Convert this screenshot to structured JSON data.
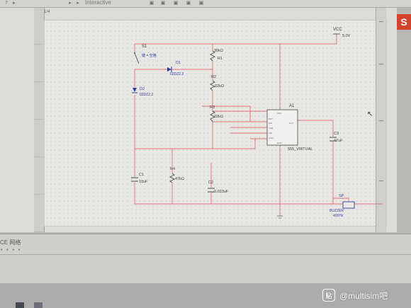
{
  "toolbar": {
    "mode_label": "Interactive"
  },
  "app": {
    "logo_letter": "S"
  },
  "ruler": {
    "label": "1/4"
  },
  "schematic": {
    "vcc": {
      "name": "VCC",
      "value": "5.0V"
    },
    "switch": {
      "ref": "S1",
      "key": "键 = 空格"
    },
    "d1": {
      "ref": "D1",
      "model": "02DZ2.2"
    },
    "d2": {
      "ref": "D2",
      "model": "02DZ2.2"
    },
    "r1": {
      "ref": "R1",
      "value": "30kΩ"
    },
    "r2": {
      "ref": "R2",
      "value": "22kΩ"
    },
    "r3": {
      "ref": "R3",
      "value": "22kΩ"
    },
    "r4": {
      "ref": "R4",
      "value": "47kΩ"
    },
    "c1": {
      "ref": "C1",
      "value": "10uF"
    },
    "c2": {
      "ref": "C2",
      "value": "0.033uF"
    },
    "c3": {
      "ref": "C3",
      "value": "47uF"
    },
    "a1": {
      "ref": "A1",
      "model": "555_VIRTUAL",
      "pins": [
        "VCC",
        "RST",
        "DIS",
        "THR",
        "TRI",
        "CON",
        "GND",
        "OUT"
      ]
    },
    "buzzer": {
      "ref": "SP",
      "model": "BUZZER",
      "freq": "400Hz"
    }
  },
  "spreadsheet": {
    "label": "CE 网络",
    "dots": "• • • •"
  },
  "watermark": {
    "logo": "贴",
    "text": "@multisim吧"
  },
  "colors": {
    "wire": "#e0707a",
    "component": "#4a4a4a",
    "diode": "#2d3f9e",
    "text": "#3c3c3c"
  }
}
